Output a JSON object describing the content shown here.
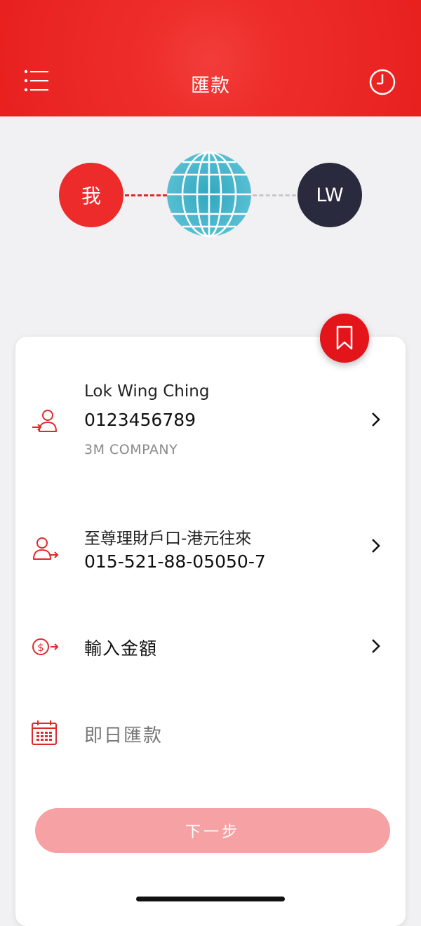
{
  "header": {
    "title": "匯款",
    "menu_icon": "menu-icon",
    "history_icon": "clock-icon",
    "color": "#e8211f"
  },
  "flow": {
    "sender_label": "我",
    "receiver_initials": "LW",
    "globe_icon": "globe-icon"
  },
  "payee": {
    "name": "Lok Wing Ching",
    "account": "0123456789",
    "company": "3M COMPANY"
  },
  "from_account": {
    "name": "至尊理財戶口-港元往來",
    "number": "015-521-88-05050-7"
  },
  "amount": {
    "label": "輸入金額"
  },
  "schedule": {
    "label": "即日匯款"
  },
  "next_button": {
    "label": "下一步",
    "color": "#f6a1a3"
  }
}
